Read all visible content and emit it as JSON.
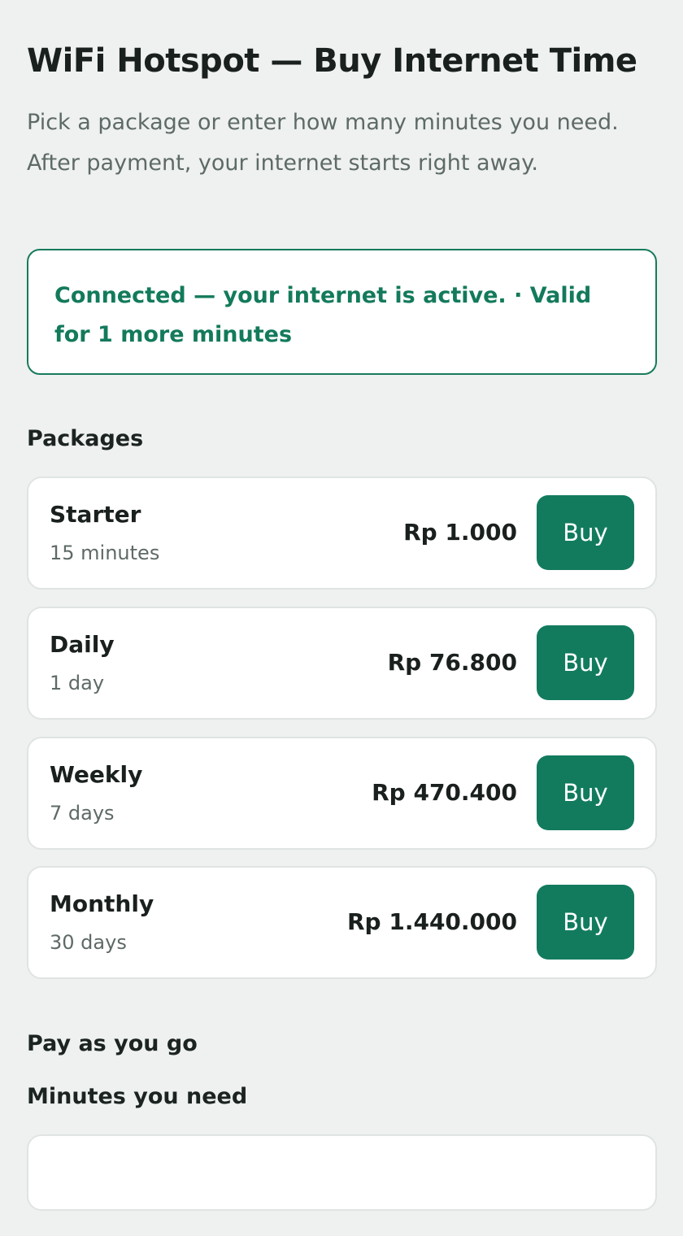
{
  "header": {
    "title": "WiFi Hotspot — Buy Internet Time",
    "subtitle": "Pick a package or enter how many minutes you need. After payment, your internet starts right away."
  },
  "status": {
    "message": "Connected — your internet is active. · Valid for 1 more minutes"
  },
  "packages": {
    "title": "Packages",
    "items": [
      {
        "name": "Starter",
        "duration": "15 minutes",
        "price": "Rp 1.000",
        "button": "Buy"
      },
      {
        "name": "Daily",
        "duration": "1 day",
        "price": "Rp 76.800",
        "button": "Buy"
      },
      {
        "name": "Weekly",
        "duration": "7 days",
        "price": "Rp 470.400",
        "button": "Buy"
      },
      {
        "name": "Monthly",
        "duration": "30 days",
        "price": "Rp 1.440.000",
        "button": "Buy"
      }
    ]
  },
  "pay_as_you_go": {
    "title": "Pay as you go",
    "minutes_label": "Minutes you need",
    "minutes_value": ""
  },
  "colors": {
    "accent": "#127b5e",
    "background": "#eef1f0",
    "status_text": "#137a5b"
  }
}
